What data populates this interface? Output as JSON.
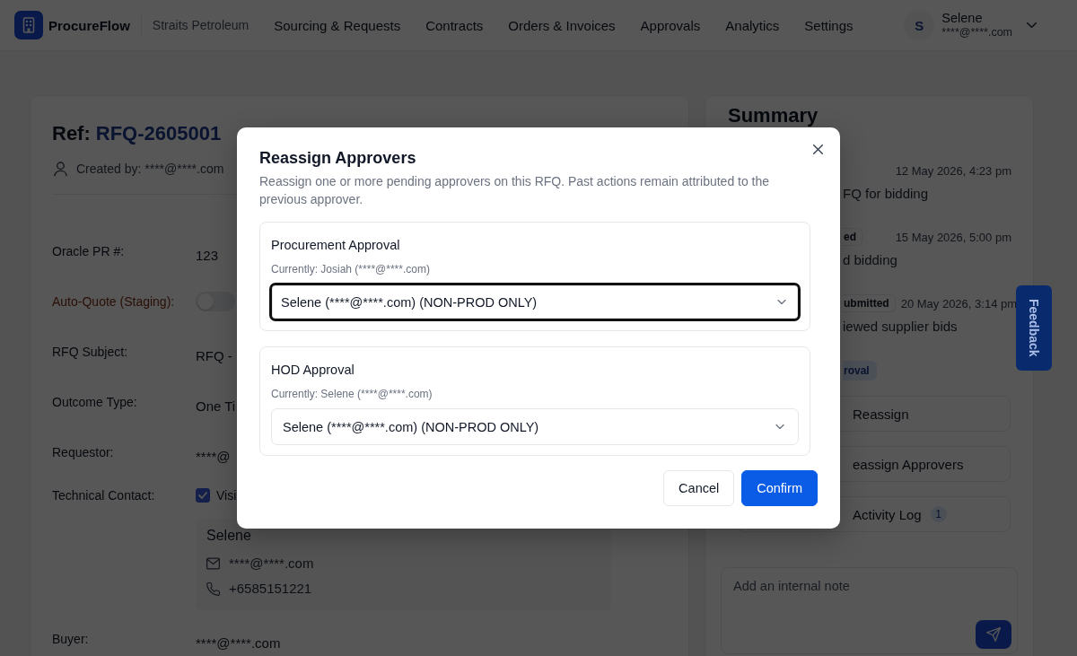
{
  "nav": {
    "brand": "ProcureFlow",
    "organization": "Straits Petroleum",
    "items": [
      {
        "label": "Sourcing & Requests",
        "selected": false
      },
      {
        "label": "Contracts",
        "selected": false
      },
      {
        "label": "Orders & Invoices",
        "selected": false
      },
      {
        "label": "Approvals",
        "selected": false
      },
      {
        "label": "Analytics",
        "selected": false
      },
      {
        "label": "Settings",
        "selected": false
      }
    ],
    "user": {
      "initial": "S",
      "name": "Selene",
      "email": "****@****.com"
    }
  },
  "record": {
    "ref_label": "Ref:",
    "ref_number": "RFQ-2605001",
    "created_by": "Created by: ****@****.com",
    "fields": [
      {
        "kind": "text",
        "label": "Oracle PR #:",
        "highlighted": false,
        "value": "123"
      },
      {
        "kind": "toggle",
        "label": "Auto-Quote (Staging):",
        "highlighted": true,
        "on": false
      },
      {
        "kind": "text",
        "label": "RFQ Subject:",
        "highlighted": false,
        "value": "RFQ -"
      },
      {
        "kind": "text",
        "label": "Outcome Type:",
        "highlighted": false,
        "value": "One Ti"
      },
      {
        "kind": "text",
        "label": "Requestor:",
        "highlighted": false,
        "value": "****@"
      },
      {
        "kind": "contact",
        "label": "Technical Contact:",
        "highlighted": false,
        "checkbox": {
          "label": "Visi",
          "checked": true
        },
        "contact": {
          "name": "Selene",
          "email": "****@****.com",
          "phone": "+6585151221"
        }
      },
      {
        "kind": "text",
        "label": "Buyer:",
        "highlighted": false,
        "value": "****@****.com"
      }
    ]
  },
  "summary": {
    "title": "Summary",
    "events": [
      {
        "date": "12 May 2026, 4:23 pm",
        "description": "FQ for bidding"
      },
      {
        "badge": "ed",
        "date": "15 May 2026, 5:00 pm",
        "description": "d bidding"
      },
      {
        "badge": "ubmitted",
        "date": "20 May 2026, 3:14 pm",
        "description": "iewed supplier bids"
      }
    ],
    "status": "roval",
    "actions": [
      {
        "label": "Reassign"
      },
      {
        "label": "eassign Approvers"
      },
      {
        "label": "Activity Log",
        "count": "1"
      }
    ],
    "note_placeholder": "Add an internal note"
  },
  "feedback": {
    "label": "Feedback"
  },
  "dialog": {
    "title": "Reassign Approvers",
    "description": "Reassign one or more pending approvers on this RFQ. Past actions remain attributed to the previous approver.",
    "sections": [
      {
        "title": "Procurement Approval",
        "current": "Currently: Josiah (****@****.com)",
        "value": "Selene (****@****.com) (NON-PROD ONLY)",
        "focused": true
      },
      {
        "title": "HOD Approval",
        "current": "Currently: Selene (****@****.com)",
        "value": "Selene (****@****.com) (NON-PROD ONLY)",
        "focused": false
      }
    ],
    "buttons": [
      {
        "label": "Cancel",
        "kind": "secondary"
      },
      {
        "label": "Confirm",
        "kind": "primary"
      }
    ]
  }
}
